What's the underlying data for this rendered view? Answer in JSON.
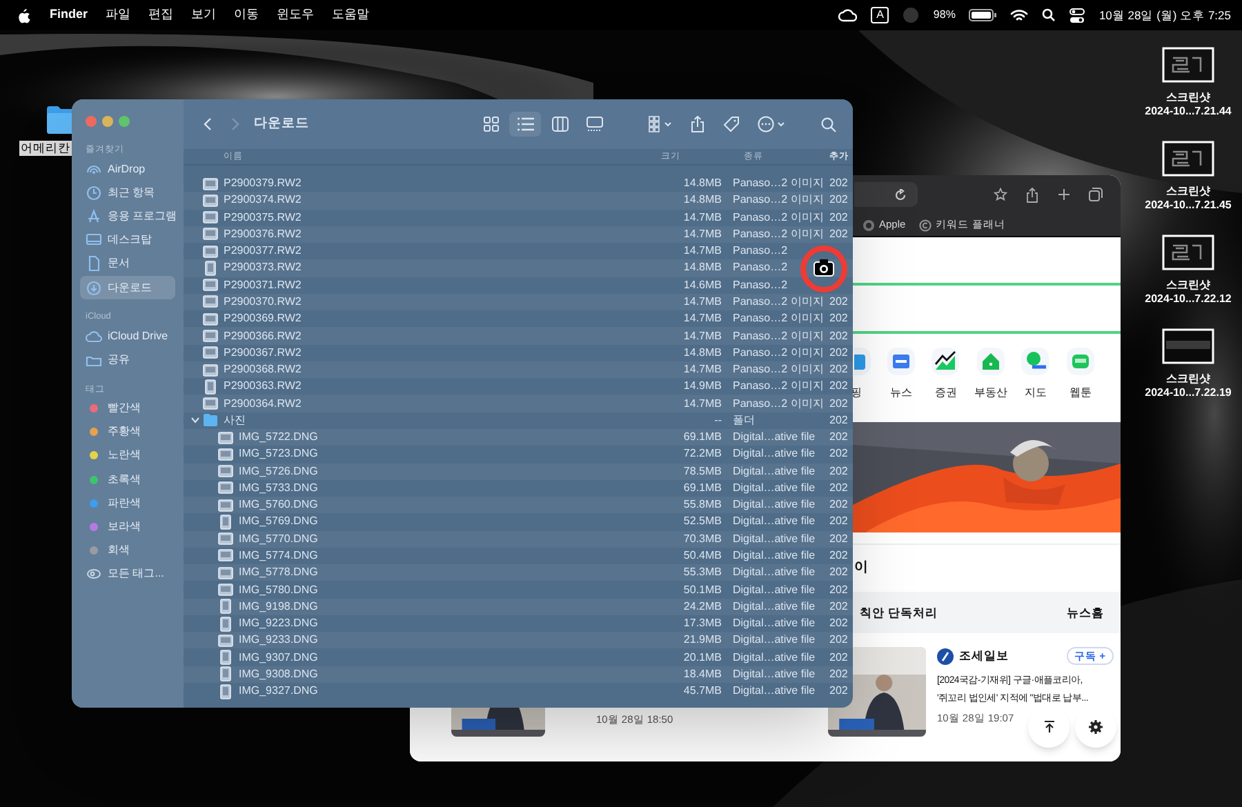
{
  "menu_bar": {
    "app": "Finder",
    "menus": [
      "파일",
      "편집",
      "보기",
      "이동",
      "윈도우",
      "도움말"
    ],
    "input_source": "A",
    "battery": "98%",
    "clock": "10월 28일 (월) 오후 7:25"
  },
  "desktop_folder": {
    "label": "어메리칸"
  },
  "desktop_screenshots": [
    {
      "kind": "pattern",
      "title": "스크린샷",
      "subtitle": "2024-10...7.21.44"
    },
    {
      "kind": "pattern",
      "title": "스크린샷",
      "subtitle": "2024-10...7.21.45"
    },
    {
      "kind": "pattern",
      "title": "스크린샷",
      "subtitle": "2024-10...7.22.12"
    },
    {
      "kind": "plain",
      "title": "스크린샷",
      "subtitle": "2024-10...7.22.19"
    }
  ],
  "browser": {
    "bookmarks": [
      {
        "kind": "apple",
        "label": "Apple"
      },
      {
        "kind": "copyright",
        "label": "키워드 플래너"
      }
    ],
    "shortcuts": [
      {
        "kind": "shopping",
        "label": "핑"
      },
      {
        "kind": "news",
        "label": "뉴스"
      },
      {
        "kind": "stock",
        "label": "증권"
      },
      {
        "kind": "realestate",
        "label": "부동산"
      },
      {
        "kind": "map",
        "label": "지도"
      },
      {
        "kind": "webtoon",
        "label": "웹툰"
      }
    ],
    "section_title": "이",
    "news_bar": {
      "title": "칙안 단독처리",
      "link": "뉴스홈"
    },
    "articles": [
      {
        "date": "10월 28일 18:50"
      },
      {
        "publisher": "조세일보",
        "subscribe": "구독 +",
        "headline_lines": [
          "[2024국감-기재위] 구글·애플코리아,",
          "'쥐꼬리 법인세' 지적에 \"법대로 납부..."
        ],
        "date": "10월 28일 19:07"
      }
    ]
  },
  "finder": {
    "title": "다운로드",
    "sidebar": [
      {
        "heading": "즐겨찾기",
        "items": [
          {
            "kind": "airdrop",
            "label": "AirDrop",
            "selected": false
          },
          {
            "kind": "recent",
            "label": "최근 항목",
            "selected": false
          },
          {
            "kind": "apps",
            "label": "응용 프로그램",
            "selected": false
          },
          {
            "kind": "desktop",
            "label": "데스크탑",
            "selected": false
          },
          {
            "kind": "documents",
            "label": "문서",
            "selected": false
          },
          {
            "kind": "downloads",
            "label": "다운로드",
            "selected": true
          }
        ]
      },
      {
        "heading": "iCloud",
        "items": [
          {
            "kind": "icloud",
            "label": "iCloud Drive",
            "selected": false
          },
          {
            "kind": "shared",
            "label": "공유",
            "selected": false
          }
        ]
      },
      {
        "heading": "태그",
        "items": [
          {
            "kind": "tag",
            "label": "빨간색",
            "color": "#ec6b78",
            "selected": false
          },
          {
            "kind": "tag",
            "label": "주황색",
            "color": "#e6a24c",
            "selected": false
          },
          {
            "kind": "tag",
            "label": "노란색",
            "color": "#e3d348",
            "selected": false
          },
          {
            "kind": "tag",
            "label": "초록색",
            "color": "#3cc46e",
            "selected": false
          },
          {
            "kind": "tag",
            "label": "파란색",
            "color": "#3a9ef2",
            "selected": false
          },
          {
            "kind": "tag",
            "label": "보라색",
            "color": "#b57ae2",
            "selected": false
          },
          {
            "kind": "tag",
            "label": "회색",
            "color": "#9b9ca1",
            "selected": false
          },
          {
            "kind": "all-tags",
            "label": "모든 태그...",
            "selected": false
          }
        ]
      }
    ],
    "columns": [
      "이름",
      "크기",
      "종류",
      "추가"
    ],
    "rows": [
      {
        "kind": "landscape",
        "name": "P2900379.RW2",
        "size": "14.8MB",
        "type": "Panaso…2 이미지",
        "date": "202"
      },
      {
        "kind": "landscape",
        "name": "P2900374.RW2",
        "size": "14.8MB",
        "type": "Panaso…2 이미지",
        "date": "202"
      },
      {
        "kind": "landscape",
        "name": "P2900375.RW2",
        "size": "14.7MB",
        "type": "Panaso…2 이미지",
        "date": "202"
      },
      {
        "kind": "landscape",
        "name": "P2900376.RW2",
        "size": "14.7MB",
        "type": "Panaso…2 이미지",
        "date": "202"
      },
      {
        "kind": "landscape",
        "name": "P2900377.RW2",
        "size": "14.7MB",
        "type": "Panaso…2"
      },
      {
        "kind": "portrait",
        "name": "P2900373.RW2",
        "size": "14.8MB",
        "type": "Panaso…2"
      },
      {
        "kind": "landscape",
        "name": "P2900371.RW2",
        "size": "14.6MB",
        "type": "Panaso…2"
      },
      {
        "kind": "landscape",
        "name": "P2900370.RW2",
        "size": "14.7MB",
        "type": "Panaso…2 이미지",
        "date": "202"
      },
      {
        "kind": "landscape",
        "name": "P2900369.RW2",
        "size": "14.7MB",
        "type": "Panaso…2 이미지",
        "date": "202"
      },
      {
        "kind": "landscape",
        "name": "P2900366.RW2",
        "size": "14.7MB",
        "type": "Panaso…2 이미지",
        "date": "202"
      },
      {
        "kind": "landscape",
        "name": "P2900367.RW2",
        "size": "14.8MB",
        "type": "Panaso…2 이미지",
        "date": "202"
      },
      {
        "kind": "landscape",
        "name": "P2900368.RW2",
        "size": "14.7MB",
        "type": "Panaso…2 이미지",
        "date": "202"
      },
      {
        "kind": "portrait",
        "name": "P2900363.RW2",
        "size": "14.9MB",
        "type": "Panaso…2 이미지",
        "date": "202"
      },
      {
        "kind": "landscape",
        "name": "P2900364.RW2",
        "size": "14.7MB",
        "type": "Panaso…2 이미지",
        "date": "202"
      },
      {
        "kind": "folder",
        "name": "사진",
        "size": "--",
        "type": "폴더",
        "date": "202",
        "expanded": true,
        "children": [
          {
            "kind": "landscape",
            "name": "IMG_5722.DNG",
            "size": "69.1MB",
            "type": "Digital…ative file",
            "date": "202"
          },
          {
            "kind": "landscape",
            "name": "IMG_5723.DNG",
            "size": "72.2MB",
            "type": "Digital…ative file",
            "date": "202"
          },
          {
            "kind": "landscape",
            "name": "IMG_5726.DNG",
            "size": "78.5MB",
            "type": "Digital…ative file",
            "date": "202"
          },
          {
            "kind": "landscape",
            "name": "IMG_5733.DNG",
            "size": "69.1MB",
            "type": "Digital…ative file",
            "date": "202"
          },
          {
            "kind": "landscape",
            "name": "IMG_5760.DNG",
            "size": "55.8MB",
            "type": "Digital…ative file",
            "date": "202"
          },
          {
            "kind": "portrait",
            "name": "IMG_5769.DNG",
            "size": "52.5MB",
            "type": "Digital…ative file",
            "date": "202"
          },
          {
            "kind": "landscape",
            "name": "IMG_5770.DNG",
            "size": "70.3MB",
            "type": "Digital…ative file",
            "date": "202"
          },
          {
            "kind": "landscape",
            "name": "IMG_5774.DNG",
            "size": "50.4MB",
            "type": "Digital…ative file",
            "date": "202"
          },
          {
            "kind": "landscape",
            "name": "IMG_5778.DNG",
            "size": "55.3MB",
            "type": "Digital…ative file",
            "date": "202"
          },
          {
            "kind": "landscape",
            "name": "IMG_5780.DNG",
            "size": "50.1MB",
            "type": "Digital…ative file",
            "date": "202"
          },
          {
            "kind": "portrait",
            "name": "IMG_9198.DNG",
            "size": "24.2MB",
            "type": "Digital…ative file",
            "date": "202"
          },
          {
            "kind": "portrait",
            "name": "IMG_9223.DNG",
            "size": "17.3MB",
            "type": "Digital…ative file",
            "date": "202"
          },
          {
            "kind": "landscape",
            "name": "IMG_9233.DNG",
            "size": "21.9MB",
            "type": "Digital…ative file",
            "date": "202"
          },
          {
            "kind": "portrait",
            "name": "IMG_9307.DNG",
            "size": "20.1MB",
            "type": "Digital…ative file",
            "date": "202"
          },
          {
            "kind": "portrait",
            "name": "IMG_9308.DNG",
            "size": "18.4MB",
            "type": "Digital…ative file",
            "date": "202"
          },
          {
            "kind": "portrait",
            "name": "IMG_9327.DNG",
            "size": "45.7MB",
            "type": "Digital…ative file",
            "date": "202"
          }
        ]
      }
    ]
  }
}
